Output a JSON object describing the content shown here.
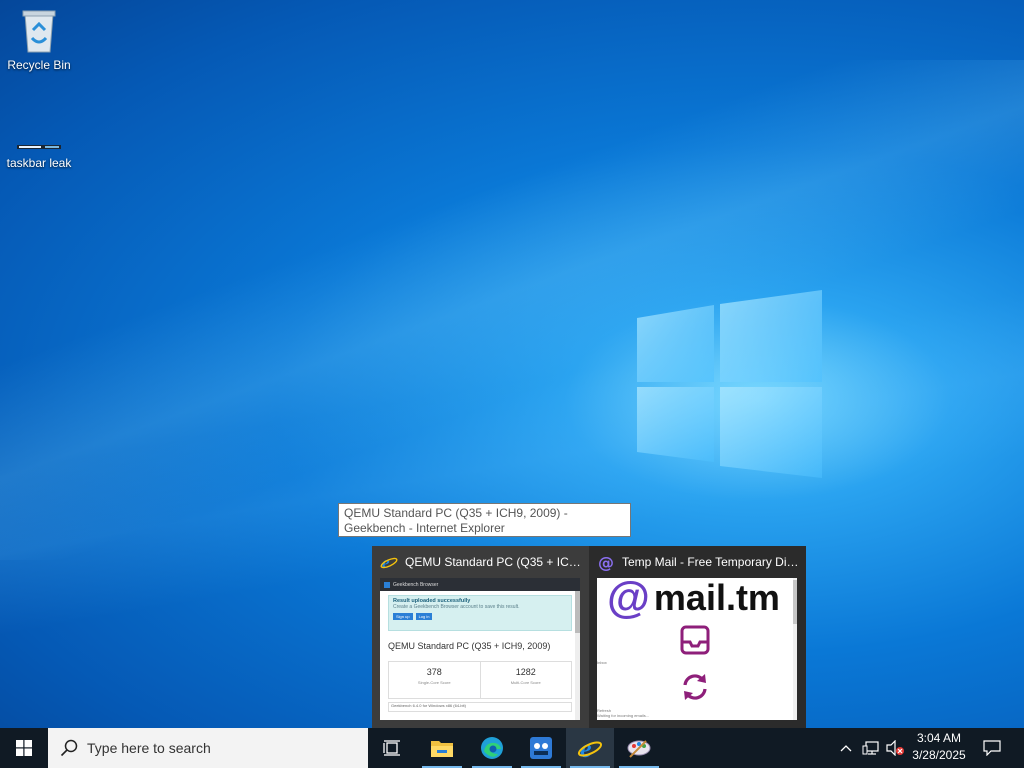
{
  "desktop": {
    "icons": [
      {
        "label": "Recycle Bin",
        "icon": "recycle-bin-icon"
      },
      {
        "label": "taskbar leak",
        "icon": "shortcut-icon"
      }
    ]
  },
  "tooltip": {
    "text": "QEMU Standard PC (Q35 + ICH9, 2009) - Geekbench - Internet Explorer"
  },
  "thumbnails": [
    {
      "title": "QEMU Standard PC (Q35 + ICH...",
      "icon": "internet-explorer-icon",
      "preview": {
        "app_name": "Geekbench Browser",
        "alert_title": "Result uploaded successfully",
        "alert_body": "Create a Geekbench Browser account to save this result.",
        "btn_signup": "Sign up",
        "btn_login": "Log in",
        "heading": "QEMU Standard PC (Q35 + ICH9, 2009)",
        "scores": [
          {
            "value": "378",
            "label": "Single-Core Score"
          },
          {
            "value": "1282",
            "label": "Multi-Core Score"
          }
        ],
        "footer": "Geekbench 6.4.0 for Windows x86 (64-bit)"
      }
    },
    {
      "title": "Temp Mail - Free Temporary Dis...",
      "icon": "mail-tm-icon",
      "preview": {
        "logo_text": "mail.tm",
        "logo_at": "@",
        "small1": "Inbox",
        "small2": "Refresh",
        "small3": "Waiting for incoming emails..."
      }
    }
  ],
  "taskbar": {
    "search_placeholder": "Type here to search",
    "apps": [
      {
        "name": "task-view",
        "active": false
      },
      {
        "name": "file-explorer",
        "active": false,
        "running": true
      },
      {
        "name": "edge",
        "active": false,
        "running": true
      },
      {
        "name": "geekbench",
        "active": false,
        "running": true
      },
      {
        "name": "internet-explorer",
        "active": true,
        "running": true
      },
      {
        "name": "paint",
        "active": false,
        "running": true
      }
    ],
    "clock_time": "3:04 AM",
    "clock_date": "3/28/2025"
  },
  "colors": {
    "accent": "#76b9ed",
    "taskbar": "#101a24",
    "mail_purple": "#6a3fc6"
  }
}
